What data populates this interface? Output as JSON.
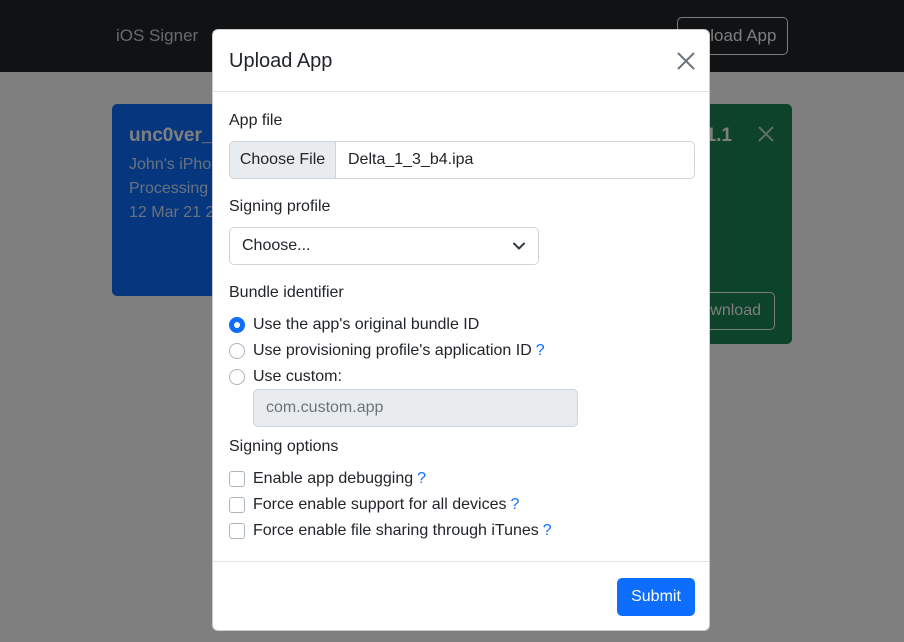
{
  "navbar": {
    "brand": "iOS Signer",
    "upload_button": "Upload App"
  },
  "cards": {
    "left": {
      "title": "unc0ver_",
      "line1": "John's iPhon",
      "line2": "Processing",
      "line3": "12 Mar 21 2"
    },
    "right": {
      "title": "1.1",
      "download_label": "wnload"
    }
  },
  "modal": {
    "title": "Upload App",
    "app_file_label": "App file",
    "choose_file_label": "Choose File",
    "file_name": "Delta_1_3_b4.ipa",
    "signing_profile_label": "Signing profile",
    "signing_profile_value": "Choose...",
    "bundle_label": "Bundle identifier",
    "bundle_options": [
      {
        "label": "Use the app's original bundle ID",
        "help": "",
        "checked": true
      },
      {
        "label": "Use provisioning profile's application ID",
        "help": "?",
        "checked": false
      },
      {
        "label": "Use custom:",
        "help": "",
        "checked": false
      }
    ],
    "custom_placeholder": "com.custom.app",
    "signing_options_label": "Signing options",
    "signing_options": [
      {
        "label": "Enable app debugging",
        "help": "?"
      },
      {
        "label": "Force enable support for all devices",
        "help": "?"
      },
      {
        "label": "Force enable file sharing through iTunes",
        "help": "?"
      }
    ],
    "submit_label": "Submit"
  },
  "colors": {
    "primary": "#0d6efd",
    "navbar": "#212529",
    "card_blue": "#0d6efd",
    "card_green": "#198754"
  }
}
